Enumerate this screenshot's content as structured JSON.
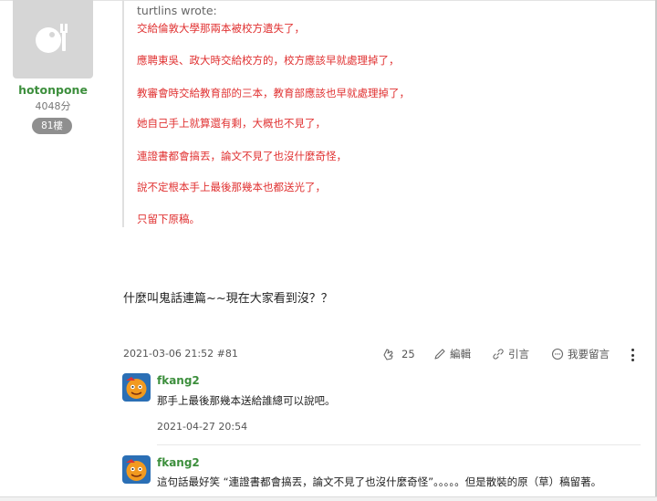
{
  "user": {
    "name": "hotonpone",
    "points": "4048分",
    "floor_badge": "81樓"
  },
  "quote": {
    "author": "turtlins wrote:",
    "lines": [
      "交給倫敦大學那兩本被校方遺失了，",
      "應聘東吳、政大時交給校方的，校方應該早就處理掉了，",
      "教審會時交給教育部的三本，教育部應該也早就處理掉了，",
      "她自己手上就算還有剩，大概也不見了，",
      "連證書都會搞丟，論文不見了也沒什麼奇怪，",
      "說不定根本手上最後那幾本也都送光了，",
      "只留下原稿。"
    ]
  },
  "post": {
    "body": "什麼叫鬼話連篇~~現在大家看到沒？？",
    "meta": "2021-03-06 21:52 #81",
    "likes": "25",
    "edit_label": "編輯",
    "quote_label": "引言",
    "comment_label": "我要留言"
  },
  "comments": [
    {
      "name": "fkang2",
      "text": "那手上最後那幾本送給誰總可以說吧。",
      "date": "2021-04-27 20:54"
    },
    {
      "name": "fkang2",
      "text": "這句話最好笑 “連證書都會搞丟，論文不見了也沒什麼奇怪”。。。。。但是散裝的原（草）稿留著。"
    }
  ],
  "colors": {
    "username": "#3d8f3d",
    "quote_text": "#e03131",
    "badge_bg": "#8f8f8f"
  }
}
